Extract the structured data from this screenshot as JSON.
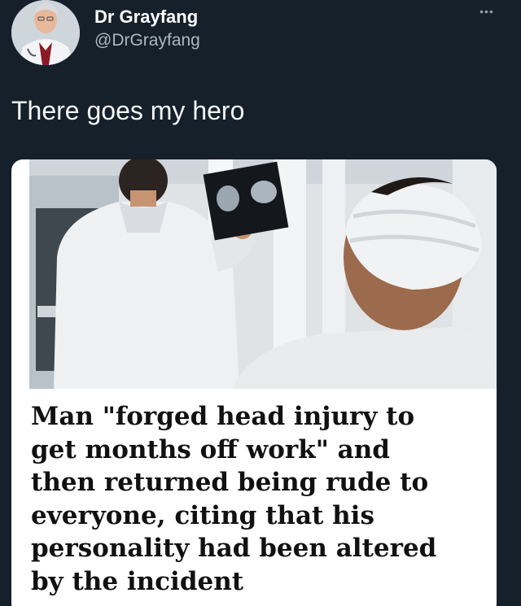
{
  "author": {
    "display_name": "Dr Grayfang",
    "handle": "@DrGrayfang",
    "avatar_icon": "doctor-portrait-avatar"
  },
  "menu": {
    "label": "•••",
    "icon": "more-options-icon"
  },
  "tweet": {
    "text": "There goes my hero"
  },
  "card": {
    "image_icon": "doctor-reviewing-xray-photo",
    "headline": "Man \"forged head injury to\nget months off work\" and\nthen returned being rude to\neveryone, citing that his\npersonality had been altered\nby the incident"
  },
  "colors": {
    "background": "#15202b",
    "card": "#ffffff",
    "handle": "#aab8c2",
    "headline": "#111111"
  }
}
